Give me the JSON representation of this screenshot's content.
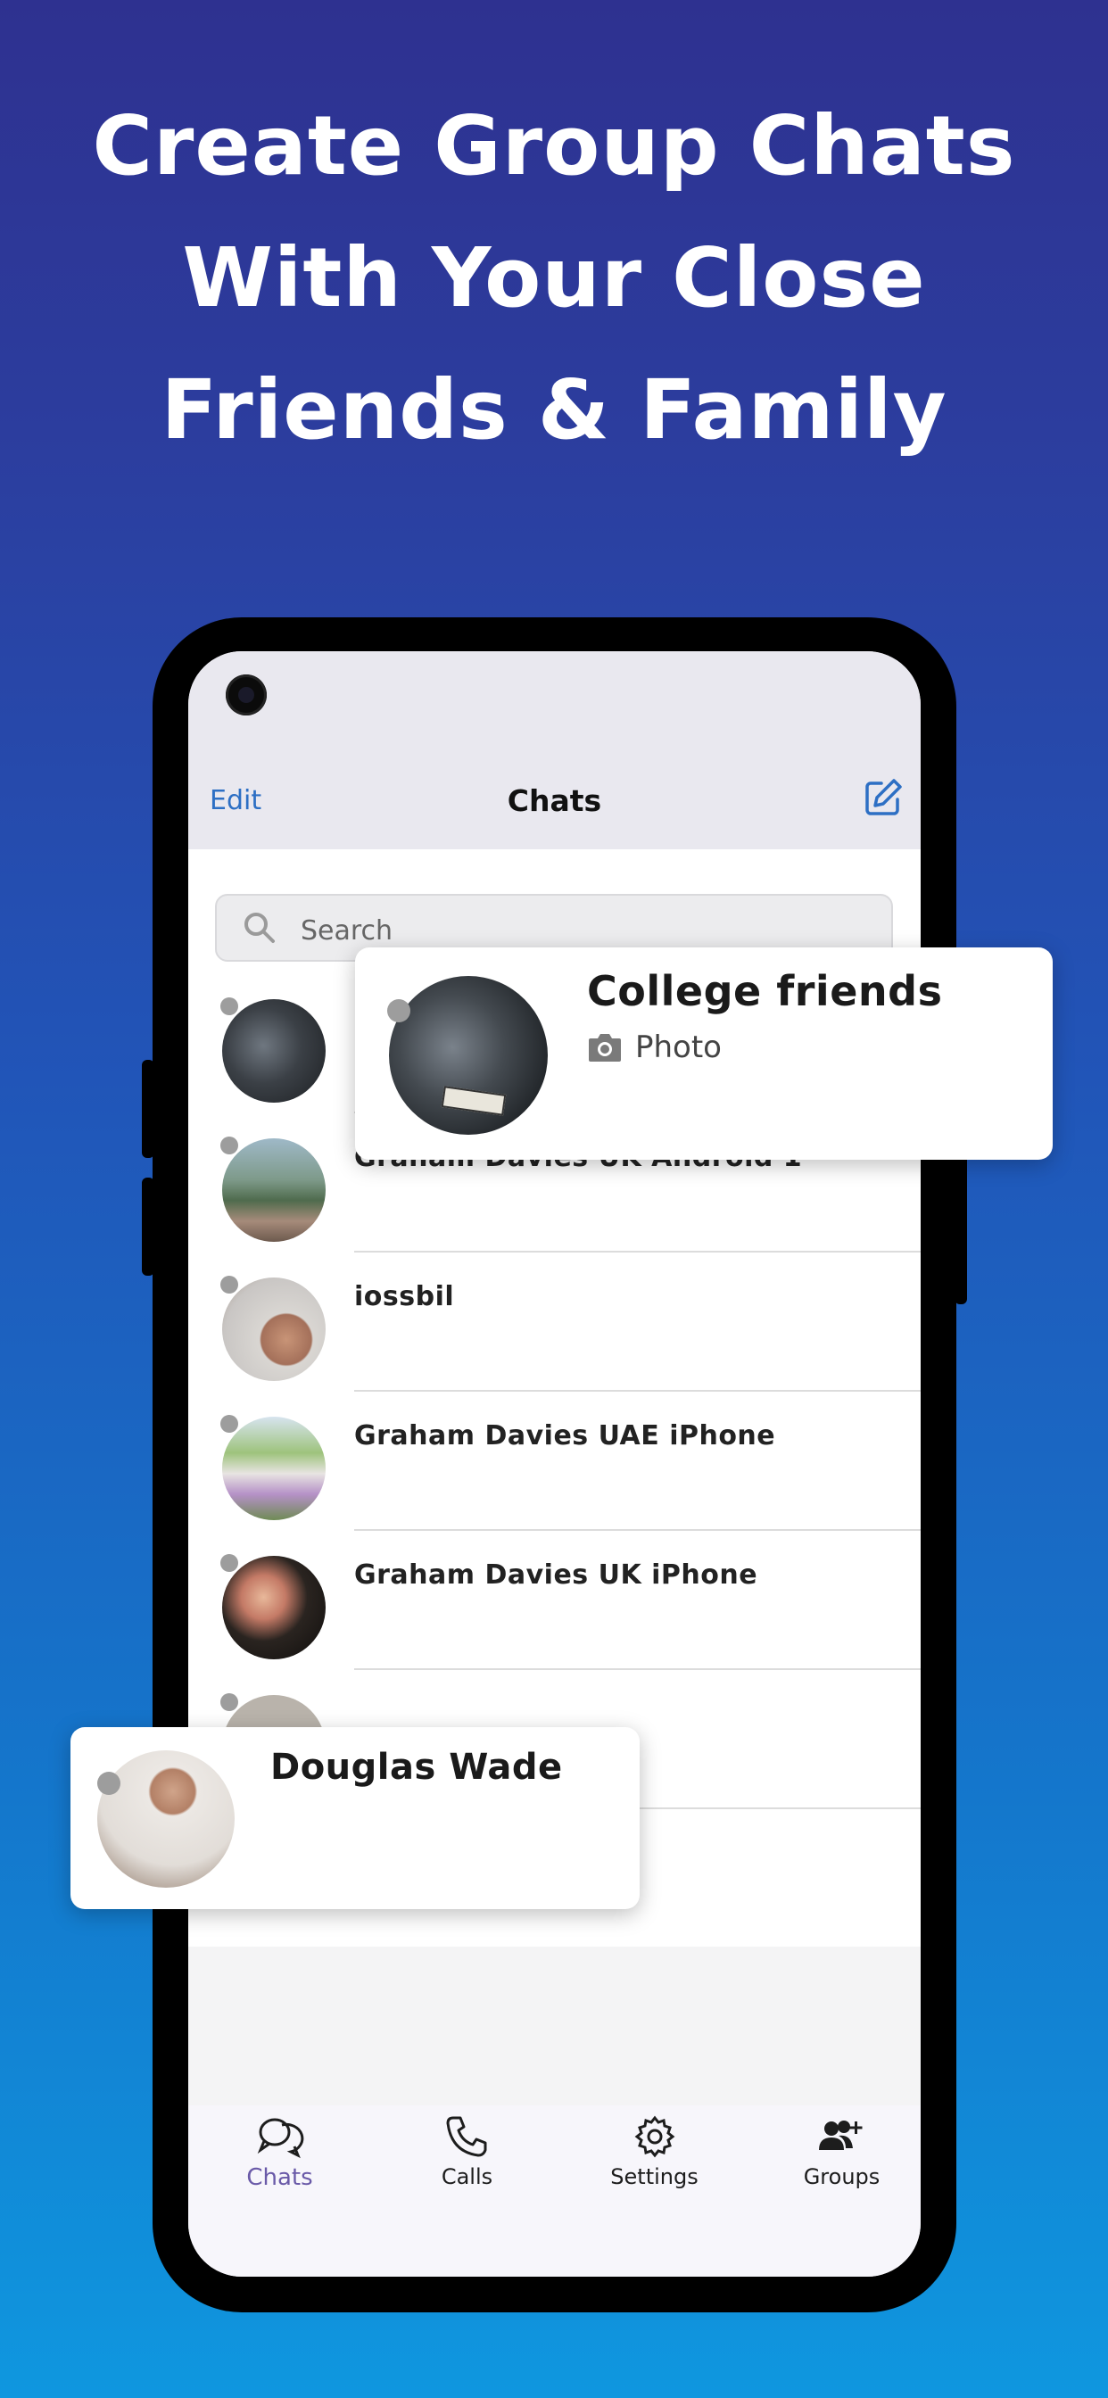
{
  "headline": {
    "line1": "Create Group Chats",
    "line2": "With Your Close",
    "line3": "Friends & Family"
  },
  "navbar": {
    "edit_label": "Edit",
    "title": "Chats",
    "compose_icon": "compose-icon"
  },
  "search": {
    "placeholder": "Search",
    "icon": "search-icon"
  },
  "chats": [
    {
      "name": ""
    },
    {
      "name": "Graham Davies UK Android 1"
    },
    {
      "name": "iossbil"
    },
    {
      "name": "Graham Davies UAE iPhone"
    },
    {
      "name": "Graham Davies UK iPhone"
    },
    {
      "name": ""
    }
  ],
  "highlight_cards": {
    "group": {
      "title": "College friends",
      "subtitle": "Photo",
      "subtitle_icon": "camera-icon"
    },
    "contact": {
      "title": "Douglas Wade"
    }
  },
  "tabbar": {
    "tabs": [
      {
        "label": "Chats",
        "icon": "chat-bubbles-icon",
        "active": true
      },
      {
        "label": "Calls",
        "icon": "phone-icon",
        "active": false
      },
      {
        "label": "Settings",
        "icon": "gear-icon",
        "active": false
      },
      {
        "label": "Groups",
        "icon": "add-person-icon",
        "active": false
      }
    ]
  },
  "colors": {
    "accent": "#2d6fc4",
    "active_tab": "#6a5aa8",
    "status_dot": "#9d9d9d"
  }
}
